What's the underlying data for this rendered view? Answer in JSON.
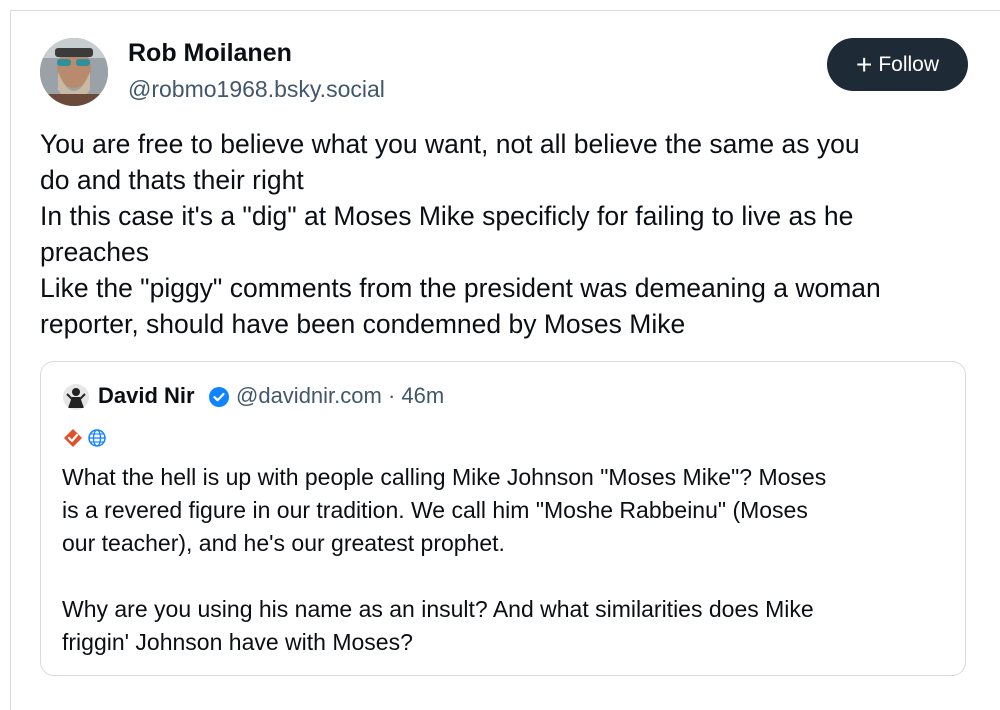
{
  "post": {
    "author_name": "Rob Moilanen",
    "author_handle": "@robmo1968.bsky.social",
    "follow_label": "Follow",
    "text_lines": [
      "You are free to believe what you want, not all believe the same as you",
      "do and thats their right",
      "In this case it's a \"dig\" at Moses Mike specificly for failing to live as he",
      "preaches",
      "Like the \"piggy\" comments from the president was demeaning a woman",
      "reporter, should have been condemned by Moses Mike"
    ]
  },
  "quote": {
    "author_name": "David Nir",
    "handle_time": "@davidnir.com · 46m",
    "paragraph1": [
      "What the hell is up with people calling Mike Johnson \"Moses Mike\"? Moses",
      "is a revered figure in our tradition. We call him \"Moshe Rabbeinu\" (Moses",
      "our teacher), and he's our greatest prophet."
    ],
    "paragraph2": [
      "Why are you using his name as an insult? And what similarities does Mike",
      "friggin' Johnson have with Moses?"
    ]
  },
  "icons": {
    "verified": "verified-check-icon",
    "badge": "red-check-badge-icon",
    "globe": "globe-icon",
    "plus": "plus-icon"
  },
  "colors": {
    "follow_bg": "#1f2a37",
    "handle": "#42576c",
    "verified": "#1083fe",
    "badge": "#e0512b"
  }
}
